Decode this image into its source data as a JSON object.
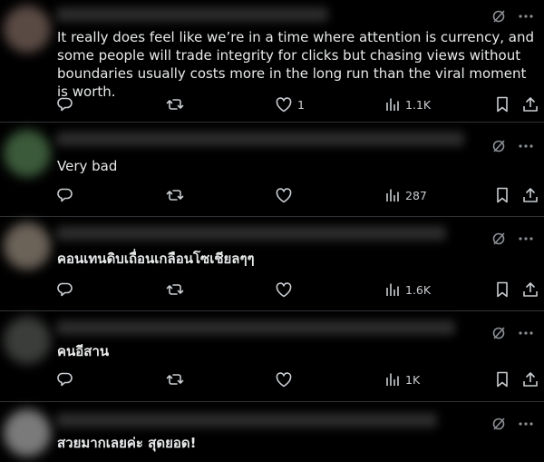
{
  "replies": [
    {
      "text": "It really does feel like we’re in a time where attention is currency, and some people will trade integrity for clicks but chasing views without boundaries usually costs more in the long run than the viral moment is worth.",
      "likes": "1",
      "views": "1.1K",
      "avatar_color": "#5a4a44"
    },
    {
      "text": "Very bad",
      "likes": "",
      "views": "287",
      "avatar_color": "#3b5a3a"
    },
    {
      "text": "คอนเทนดิบเถื่อนเกลือนโซเชียลๆๆ",
      "likes": "",
      "views": "1.6K",
      "avatar_color": "#6b6258"
    },
    {
      "text": "คนอีสาน",
      "likes": "",
      "views": "1K",
      "avatar_color": "#3a3d3a"
    },
    {
      "text": "สวยมากเลยค่ะ สุดยอด!",
      "likes": "",
      "views": "",
      "avatar_color": "#7a7a7a"
    }
  ],
  "icons": {
    "reply": "reply-icon",
    "repost": "repost-icon",
    "like": "heart-icon",
    "views": "views-icon",
    "bookmark": "bookmark-icon",
    "share": "share-icon",
    "grok": "grok-icon",
    "more": "more-dots-icon"
  },
  "colors": {
    "background": "#000000",
    "text": "#e7e9ea",
    "muted": "#71767b",
    "divider": "#2f3336"
  }
}
